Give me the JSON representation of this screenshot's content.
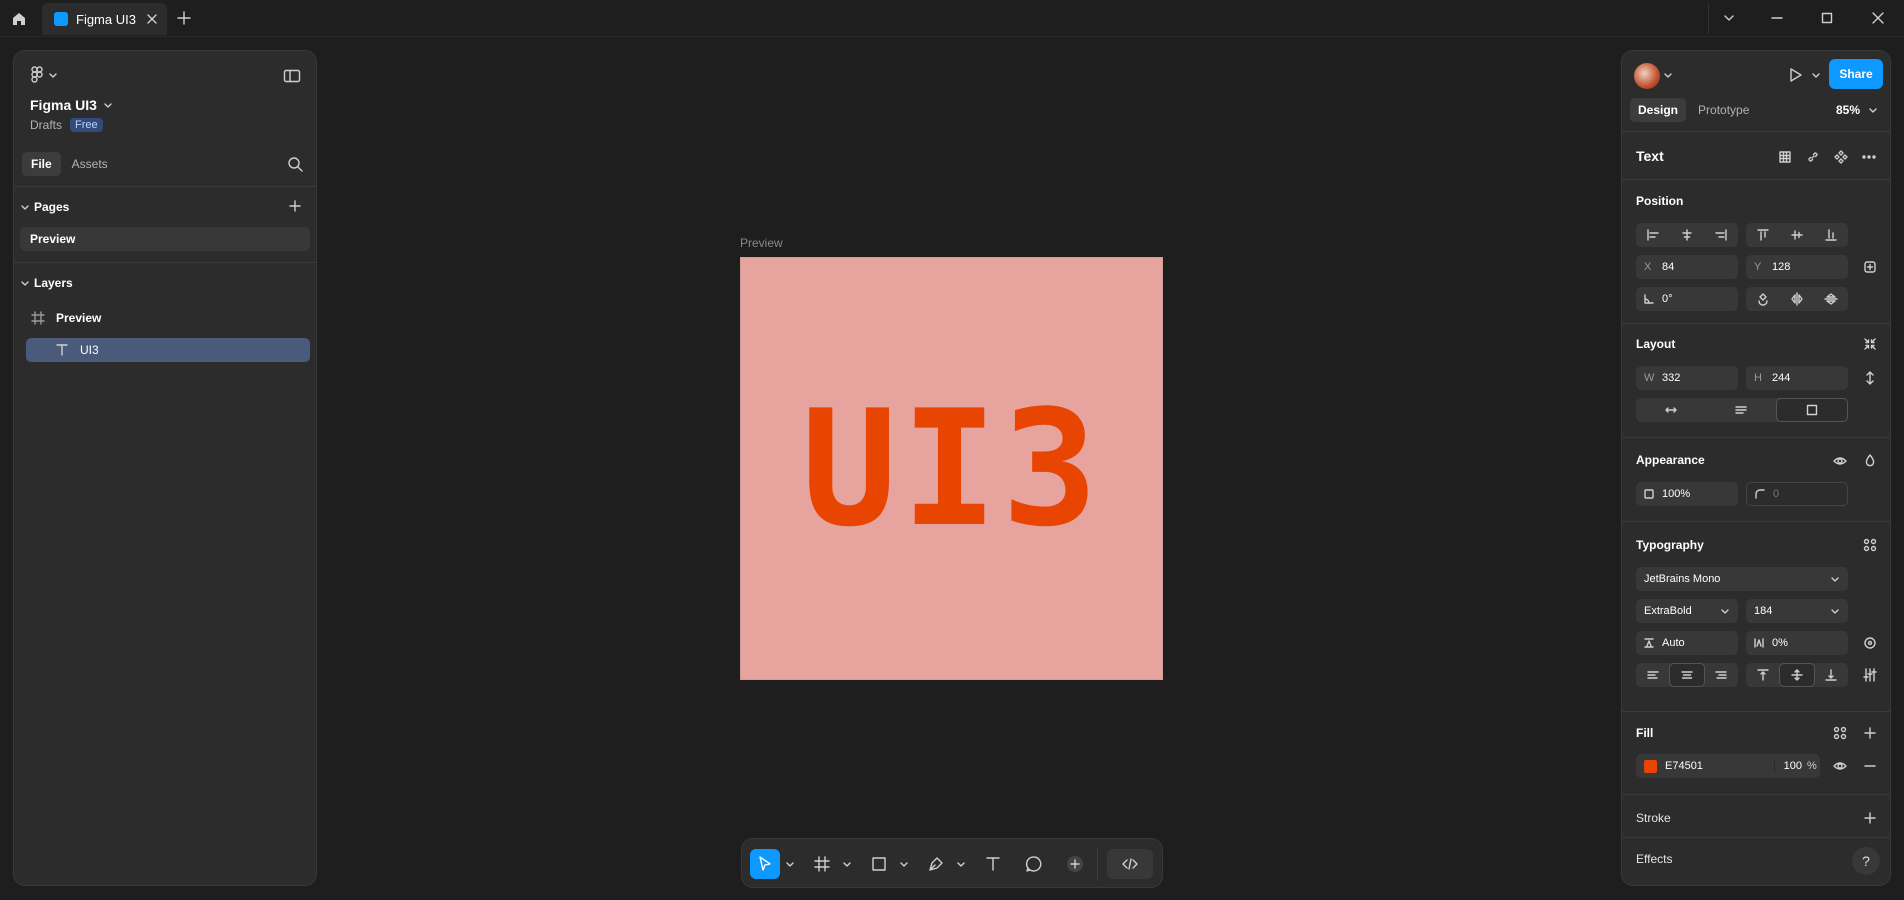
{
  "titlebar": {
    "tab_title": "Figma UI3",
    "new_tab": "+"
  },
  "left_panel": {
    "file_name": "Figma UI3",
    "location": "Drafts",
    "plan_badge": "Free",
    "tabs": [
      "File",
      "Assets"
    ],
    "pages_heading": "Pages",
    "pages": [
      "Preview"
    ],
    "layers_heading": "Layers",
    "layers": [
      {
        "name": "Preview",
        "type": "frame"
      },
      {
        "name": "UI3",
        "type": "text",
        "selected": true
      }
    ]
  },
  "canvas": {
    "frame_label": "Preview",
    "frame_text": "UI3",
    "frame_bg": "#e7a39e",
    "text_color": "#e74501"
  },
  "toolbar": {
    "tools": [
      "move-tool",
      "frame-tool",
      "rectangle-tool",
      "pen-tool",
      "text-tool",
      "comment-tool",
      "actions-tool",
      "dev-mode-toggle"
    ]
  },
  "right_panel": {
    "share_label": "Share",
    "tabs": [
      "Design",
      "Prototype"
    ],
    "zoom": "85%",
    "selection_heading": "Text",
    "position": {
      "heading": "Position",
      "x_label": "X",
      "x": "84",
      "y_label": "Y",
      "y": "128",
      "rotation": "0°"
    },
    "layout": {
      "heading": "Layout",
      "w_label": "W",
      "w": "332",
      "h_label": "H",
      "h": "244"
    },
    "appearance": {
      "heading": "Appearance",
      "opacity": "100%",
      "radius": "0"
    },
    "typography": {
      "heading": "Typography",
      "font": "JetBrains Mono",
      "weight": "ExtraBold",
      "size": "184",
      "line_height": "Auto",
      "letter_spacing": "0%"
    },
    "fill": {
      "heading": "Fill",
      "hex": "E74501",
      "opacity": "100",
      "unit": "%",
      "color": "#e74501"
    },
    "stroke_heading": "Stroke",
    "effects_heading": "Effects",
    "help": "?"
  }
}
